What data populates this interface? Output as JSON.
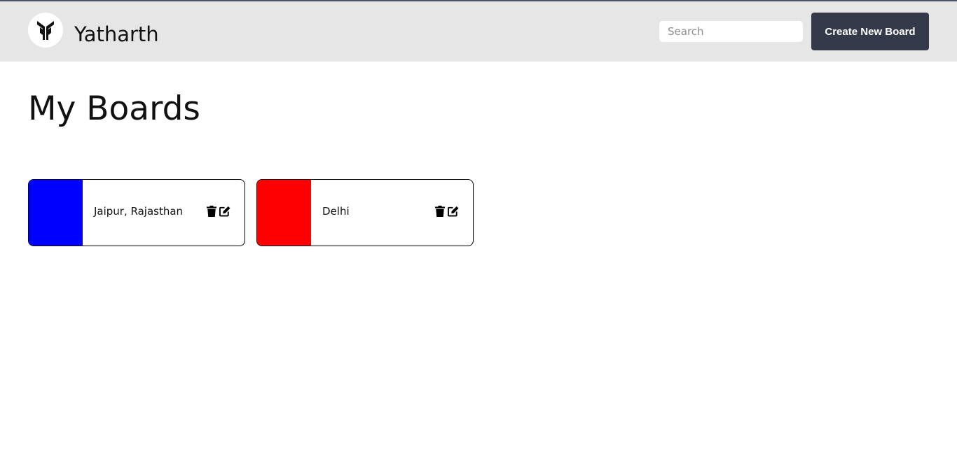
{
  "header": {
    "brand": "Yatharth",
    "logo_icon": "yatharth-logo-icon",
    "search_placeholder": "Search",
    "search_value": "",
    "create_button_label": "Create New Board",
    "background": "#e6e6e6",
    "button_color": "#343a4a"
  },
  "main": {
    "title": "My Boards",
    "boards": [
      {
        "name": "Jaipur, Rajasthan",
        "color": "#0000ff",
        "delete_icon": "trash-icon",
        "edit_icon": "edit-icon"
      },
      {
        "name": "Delhi",
        "color": "#ff0000",
        "delete_icon": "trash-icon",
        "edit_icon": "edit-icon"
      }
    ]
  }
}
